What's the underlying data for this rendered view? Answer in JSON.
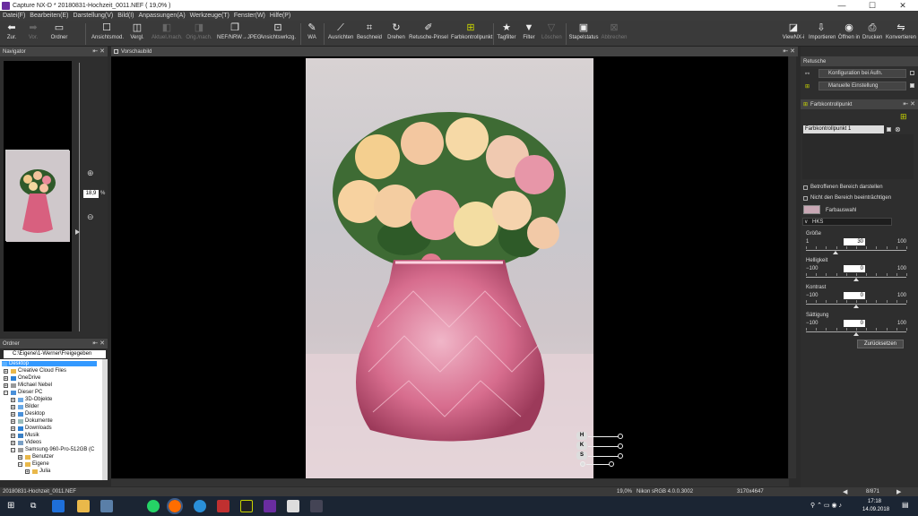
{
  "window": {
    "title": "Capture NX-D    * 20180831-Hochzeit_0011.NEF ( 19,0% )",
    "minimize": "—",
    "maximize": "☐",
    "close": "✕"
  },
  "menu": [
    "Datei(F)",
    "Bearbeiten(E)",
    "Darstellung(V)",
    "Bild(I)",
    "Anpassungen(A)",
    "Werkzeuge(T)",
    "Fenster(W)",
    "Hilfe(P)"
  ],
  "toolbar": {
    "back": "Zur.",
    "forward": "Vor.",
    "folder": "Ordner",
    "view_mode": "Ansichtsmod.",
    "compare": "Vergl.",
    "current_after": "Aktuel./nach.",
    "orig_after": "Orig./nach.",
    "convert": "NEF/NRW→JPEG",
    "view_tools": "Ansichtswrkzg.",
    "wb": "WA",
    "straighten": "Ausrichten",
    "crop": "Beschneid",
    "rotate": "Drehen",
    "retouch": "Retusche-Pinsel",
    "color_control_point": "Farbkontrollpunkt",
    "tag_filter": "Tagfilter",
    "filter": "Filter",
    "delete": "Löschen",
    "batch_status": "Stapelstatus",
    "cancel": "Abbrechen",
    "viewnx": "ViewNX-i",
    "import": "Importieren",
    "open_in": "Öffnen in",
    "print": "Drucken",
    "convert_files": "Konvertieren"
  },
  "navigator": {
    "title": "Navigator",
    "zoom_value": "18,9",
    "zoom_unit": "%"
  },
  "folders": {
    "title": "Ordner",
    "path": "C:\\Eigene\\1-Werner\\Freigegeben",
    "items": [
      {
        "label": "Desktop",
        "level": 0,
        "toggle": ""
      },
      {
        "label": "Creative Cloud Files",
        "level": 1,
        "toggle": "+"
      },
      {
        "label": "OneDrive",
        "level": 1,
        "toggle": "+"
      },
      {
        "label": "Michael Nebel",
        "level": 1,
        "toggle": "+"
      },
      {
        "label": "Dieser PC",
        "level": 1,
        "toggle": "−"
      },
      {
        "label": "3D-Objekte",
        "level": 2,
        "toggle": "+"
      },
      {
        "label": "Bilder",
        "level": 2,
        "toggle": "+"
      },
      {
        "label": "Desktop",
        "level": 2,
        "toggle": "+"
      },
      {
        "label": "Dokumente",
        "level": 2,
        "toggle": "+"
      },
      {
        "label": "Downloads",
        "level": 2,
        "toggle": "+"
      },
      {
        "label": "Musik",
        "level": 2,
        "toggle": "+"
      },
      {
        "label": "Videos",
        "level": 2,
        "toggle": "+"
      },
      {
        "label": "Samsung-960-Pro-512GB (C",
        "level": 2,
        "toggle": "−"
      },
      {
        "label": "Benutzer",
        "level": 3,
        "toggle": "+"
      },
      {
        "label": "Eigene",
        "level": 3,
        "toggle": "−"
      },
      {
        "label": "Julia",
        "level": 4,
        "toggle": "+"
      }
    ]
  },
  "preview": {
    "title": "Vorschaubild",
    "handles": [
      "H",
      "K",
      "S"
    ]
  },
  "retouch": {
    "title": "Retusche",
    "row1": "Konfiguration bei Aufn.",
    "row2": "Manuelle Einstellung"
  },
  "fcp": {
    "title": "Farbkontrollpunkt",
    "point_name": "Farbkontrollpunkt 1",
    "show_affected": "Betroffenen Bereich darstellen",
    "not_affect": "Nicht den Bereich beeinträchtigen",
    "color_pick": "Farbauswahl",
    "mode": "HKS",
    "sliders": [
      {
        "label": "Größe",
        "min": "1",
        "max": "100",
        "value": "30"
      },
      {
        "label": "Helligkeit",
        "min": "−100",
        "max": "100",
        "value": "0"
      },
      {
        "label": "Kontrast",
        "min": "−100",
        "max": "100",
        "value": "0"
      },
      {
        "label": "Sättigung",
        "min": "−100",
        "max": "100",
        "value": "0"
      }
    ],
    "reset": "Zurücksetzen"
  },
  "status": {
    "filename": "20180831-Hochzeit_0011.NEF",
    "zoom": "19,0%",
    "camera": "Nikon sRGB 4.0.0.3002",
    "dims": "3170x4647",
    "page": "8/871"
  },
  "taskbar": {
    "time": "17:18",
    "date": "14.09.2018"
  },
  "colors": {
    "accent": "#6a2da0",
    "cp_green": "#c8d400",
    "folder_yellow": "#e9b84a"
  }
}
